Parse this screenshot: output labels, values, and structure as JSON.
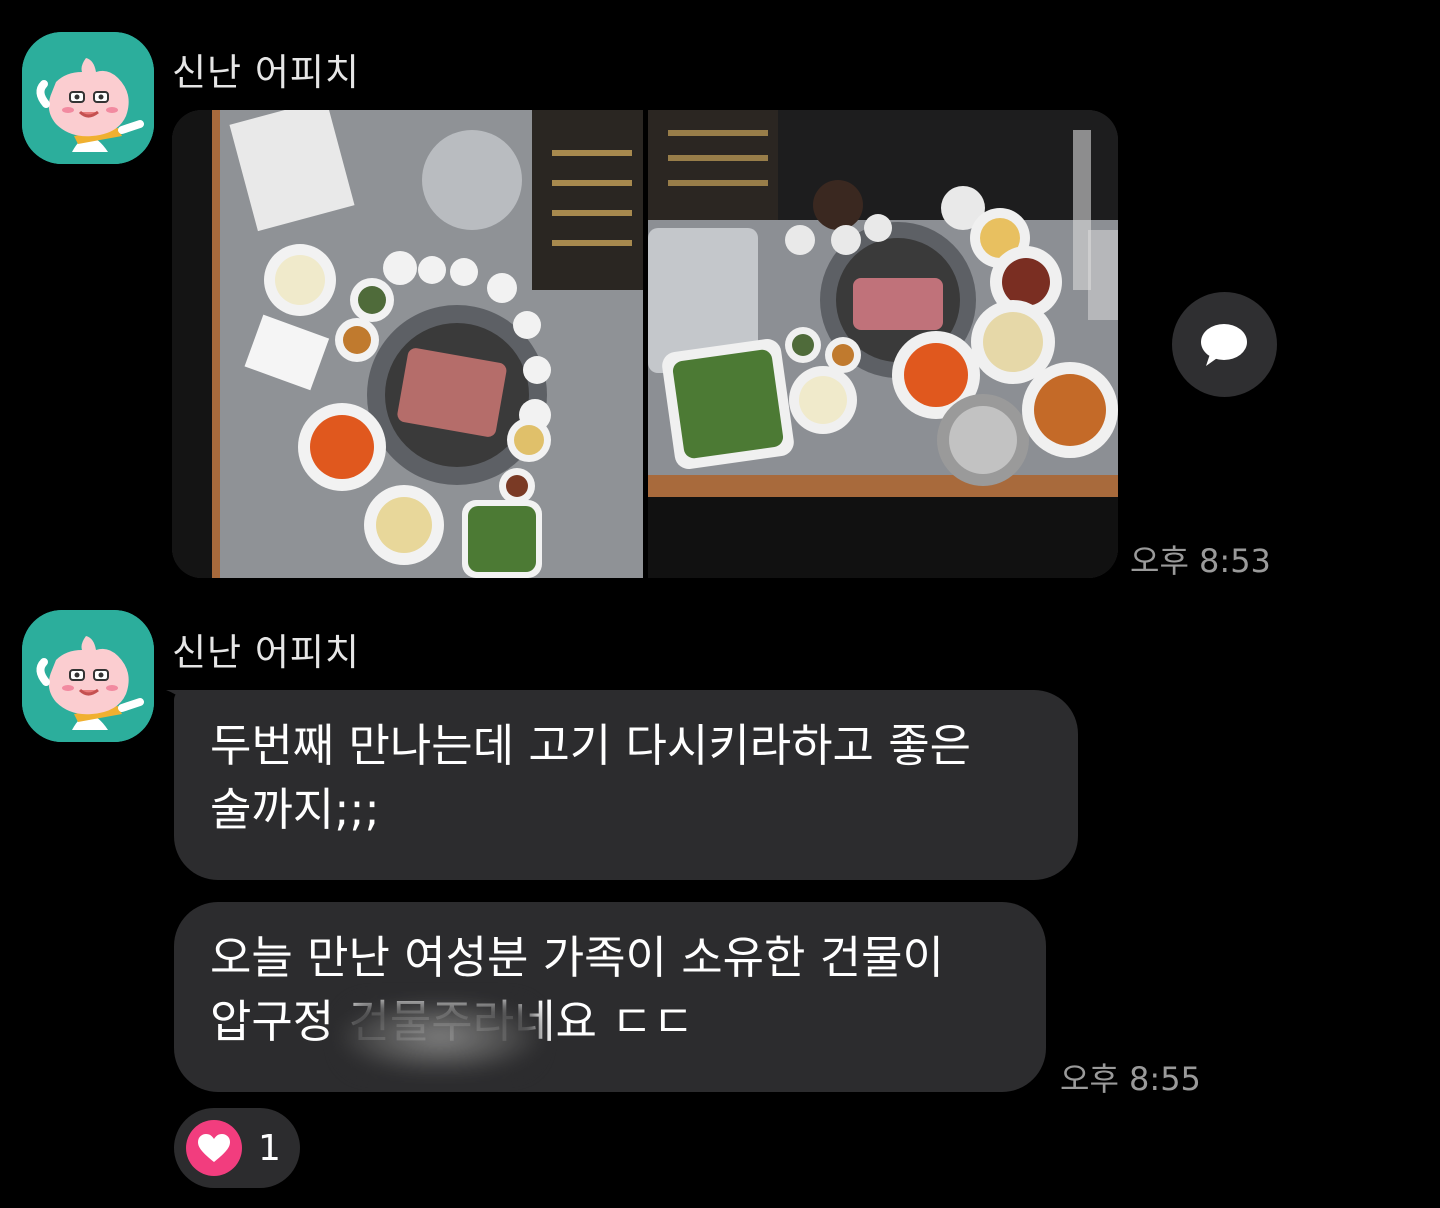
{
  "messages": {
    "group1": {
      "sender": "신난 어피치",
      "timestamp": "오후 8:53",
      "photos": [
        "food-photo",
        "food-photo"
      ]
    },
    "group2": {
      "sender": "신난 어피치",
      "bubble1": "두번째 만나는데 고기 다시키라하고 좋은\n술까지;;;",
      "bubble2": "오늘 만난 여성분 가족이 소유한 건물이\n압구정                    건물주라네요 ㄷㄷ",
      "timestamp": "오후 8:55"
    }
  },
  "reaction": {
    "icon": "heart-icon",
    "count": "1",
    "color": "#f23d7e"
  },
  "colors": {
    "background": "#000000",
    "bubble": "#2c2c2e",
    "avatar_bg": "#2cae9c",
    "timestamp": "#9a9a9a"
  }
}
